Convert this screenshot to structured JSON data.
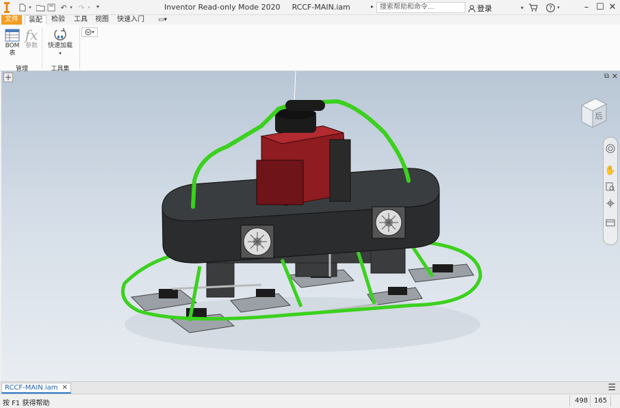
{
  "titlebar": {
    "title": "Inventor Read-only Mode 2020",
    "filename": "RCCF-MAIN.iam",
    "search_placeholder": "搜索帮助和命令...",
    "user_label": "登录"
  },
  "ribbon": {
    "tabs": [
      {
        "label": "文件"
      },
      {
        "label": "装配"
      },
      {
        "label": "检验"
      },
      {
        "label": "工具"
      },
      {
        "label": "视图"
      },
      {
        "label": "快速入门"
      }
    ],
    "panels": [
      {
        "label": "管理"
      },
      {
        "label": "工具集"
      }
    ],
    "buttons": {
      "bom_line1": "BOM",
      "bom_line2": "表",
      "params": "参数",
      "quick_load": "快速加载"
    }
  },
  "viewcube": {
    "face": "后"
  },
  "document_tabs": [
    {
      "label": "RCCF-MAIN.iam"
    }
  ],
  "statusbar": {
    "help": "按 F1 获得帮助",
    "value1": "498",
    "value2": "165"
  },
  "colors": {
    "accent_file_tab": "#f39c1d",
    "frame_green": "#3bd11e",
    "body_dark": "#2a2c2e",
    "motor_red": "#8e1c20"
  }
}
